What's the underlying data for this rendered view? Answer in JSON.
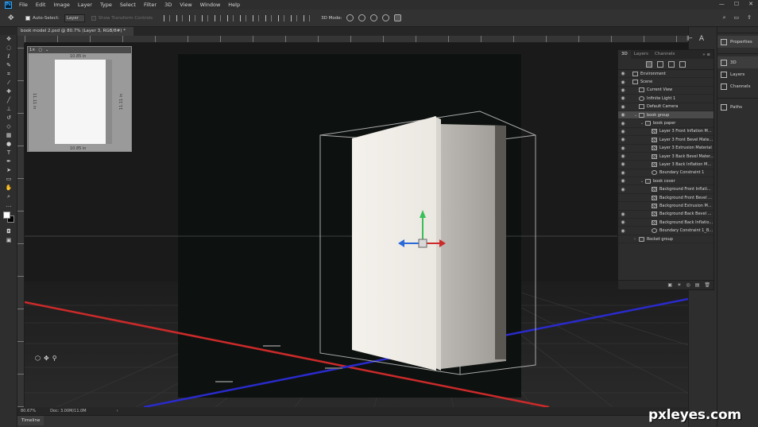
{
  "app": {
    "logo": "Ps"
  },
  "menu": [
    "File",
    "Edit",
    "Image",
    "Layer",
    "Type",
    "Select",
    "Filter",
    "3D",
    "View",
    "Window",
    "Help"
  ],
  "window_controls": {
    "minimize": "—",
    "maximize": "☐",
    "close": "✕"
  },
  "options_bar": {
    "auto_select_label": "Auto-Select:",
    "auto_select_checked": true,
    "target_value": "Layer",
    "show_transform_label": "Show Transform Controls",
    "mode_label": "3D Mode:"
  },
  "document_tab": {
    "title": "book model 2.psd @ 80.7% (Layer 3, RGB/8#) *",
    "close": "×"
  },
  "secondary_view": {
    "top_label": "10.85 in",
    "bottom_label": "10.85 in",
    "left_label": "11.11 in",
    "right_label": "11.11 in"
  },
  "status": {
    "zoom": "80.67%",
    "doc": "Doc: 3.00M/11.0M",
    "arrow": "›"
  },
  "timeline_label": "Timeline",
  "panel3d": {
    "tabs": [
      {
        "label": "3D",
        "active": true
      },
      {
        "label": "Layers",
        "active": false
      },
      {
        "label": "Channels",
        "active": false
      }
    ],
    "collapse": "» ≡",
    "tree": [
      {
        "label": "Environment",
        "indent": 0,
        "icon": "globe",
        "eye": true,
        "twisty": "",
        "selected": false
      },
      {
        "label": "Scene",
        "indent": 0,
        "icon": "scene",
        "eye": true,
        "twisty": "",
        "selected": false
      },
      {
        "label": "Current View",
        "indent": 1,
        "icon": "camera",
        "eye": true,
        "twisty": "",
        "selected": false
      },
      {
        "label": "Infinite Light 1",
        "indent": 1,
        "icon": "light",
        "eye": true,
        "twisty": "",
        "selected": false
      },
      {
        "label": "Default Camera",
        "indent": 1,
        "icon": "camera",
        "eye": true,
        "twisty": "",
        "selected": false
      },
      {
        "label": "book group",
        "indent": 1,
        "icon": "folder",
        "eye": true,
        "twisty": "⌄",
        "selected": true
      },
      {
        "label": "book paper",
        "indent": 2,
        "icon": "folder",
        "eye": true,
        "twisty": "⌄",
        "selected": false
      },
      {
        "label": "Layer 3 Front Inflation M...",
        "indent": 3,
        "icon": "mat",
        "eye": true,
        "twisty": "",
        "selected": false
      },
      {
        "label": "Layer 3 Front Bevel Mate...",
        "indent": 3,
        "icon": "mat",
        "eye": true,
        "twisty": "",
        "selected": false
      },
      {
        "label": "Layer 3 Extrusion Material",
        "indent": 3,
        "icon": "mat",
        "eye": true,
        "twisty": "",
        "selected": false
      },
      {
        "label": "Layer 3 Back Bevel Mater...",
        "indent": 3,
        "icon": "mat",
        "eye": true,
        "twisty": "",
        "selected": false
      },
      {
        "label": "Layer 3 Back Inflation M...",
        "indent": 3,
        "icon": "mat",
        "eye": true,
        "twisty": "",
        "selected": false
      },
      {
        "label": "Boundary Constraint 1",
        "indent": 3,
        "icon": "light",
        "eye": true,
        "twisty": "",
        "selected": false
      },
      {
        "label": "book cover",
        "indent": 2,
        "icon": "folder",
        "eye": true,
        "twisty": "⌄",
        "selected": false
      },
      {
        "label": "Background Front Inflati...",
        "indent": 3,
        "icon": "mat",
        "eye": true,
        "twisty": "",
        "selected": false
      },
      {
        "label": "Background Front Bevel ...",
        "indent": 3,
        "icon": "mat",
        "eye": false,
        "twisty": "",
        "selected": false
      },
      {
        "label": "Background Extrusion M...",
        "indent": 3,
        "icon": "mat",
        "eye": false,
        "twisty": "",
        "selected": false
      },
      {
        "label": "Background Back Bevel ...",
        "indent": 3,
        "icon": "mat",
        "eye": true,
        "twisty": "",
        "selected": false
      },
      {
        "label": "Background Back Inflatio...",
        "indent": 3,
        "icon": "mat",
        "eye": true,
        "twisty": "",
        "selected": false
      },
      {
        "label": "Boundary Constraint 1_B...",
        "indent": 3,
        "icon": "light",
        "eye": true,
        "twisty": "",
        "selected": false
      },
      {
        "label": "Rocket group",
        "indent": 1,
        "icon": "folder",
        "eye": false,
        "twisty": "›",
        "selected": false
      }
    ],
    "footer_icons": [
      "cube-icon",
      "light-icon",
      "render-icon",
      "new-icon",
      "delete-icon"
    ]
  },
  "right_panels": [
    {
      "label": "Properties",
      "icon": "properties-icon",
      "active": true
    },
    {
      "label": "3D",
      "icon": "3d-icon",
      "active": true
    },
    {
      "label": "Layers",
      "icon": "layers-icon",
      "active": false
    },
    {
      "label": "Channels",
      "icon": "channels-icon",
      "active": false
    },
    {
      "label": "Paths",
      "icon": "paths-icon",
      "active": false
    }
  ],
  "watermark": "pxleyes.com",
  "colors": {
    "x_axis": "#cc2a2a",
    "z_axis": "#2a2acc",
    "y_axis": "#38c05a",
    "accent": "#31a8ff"
  }
}
